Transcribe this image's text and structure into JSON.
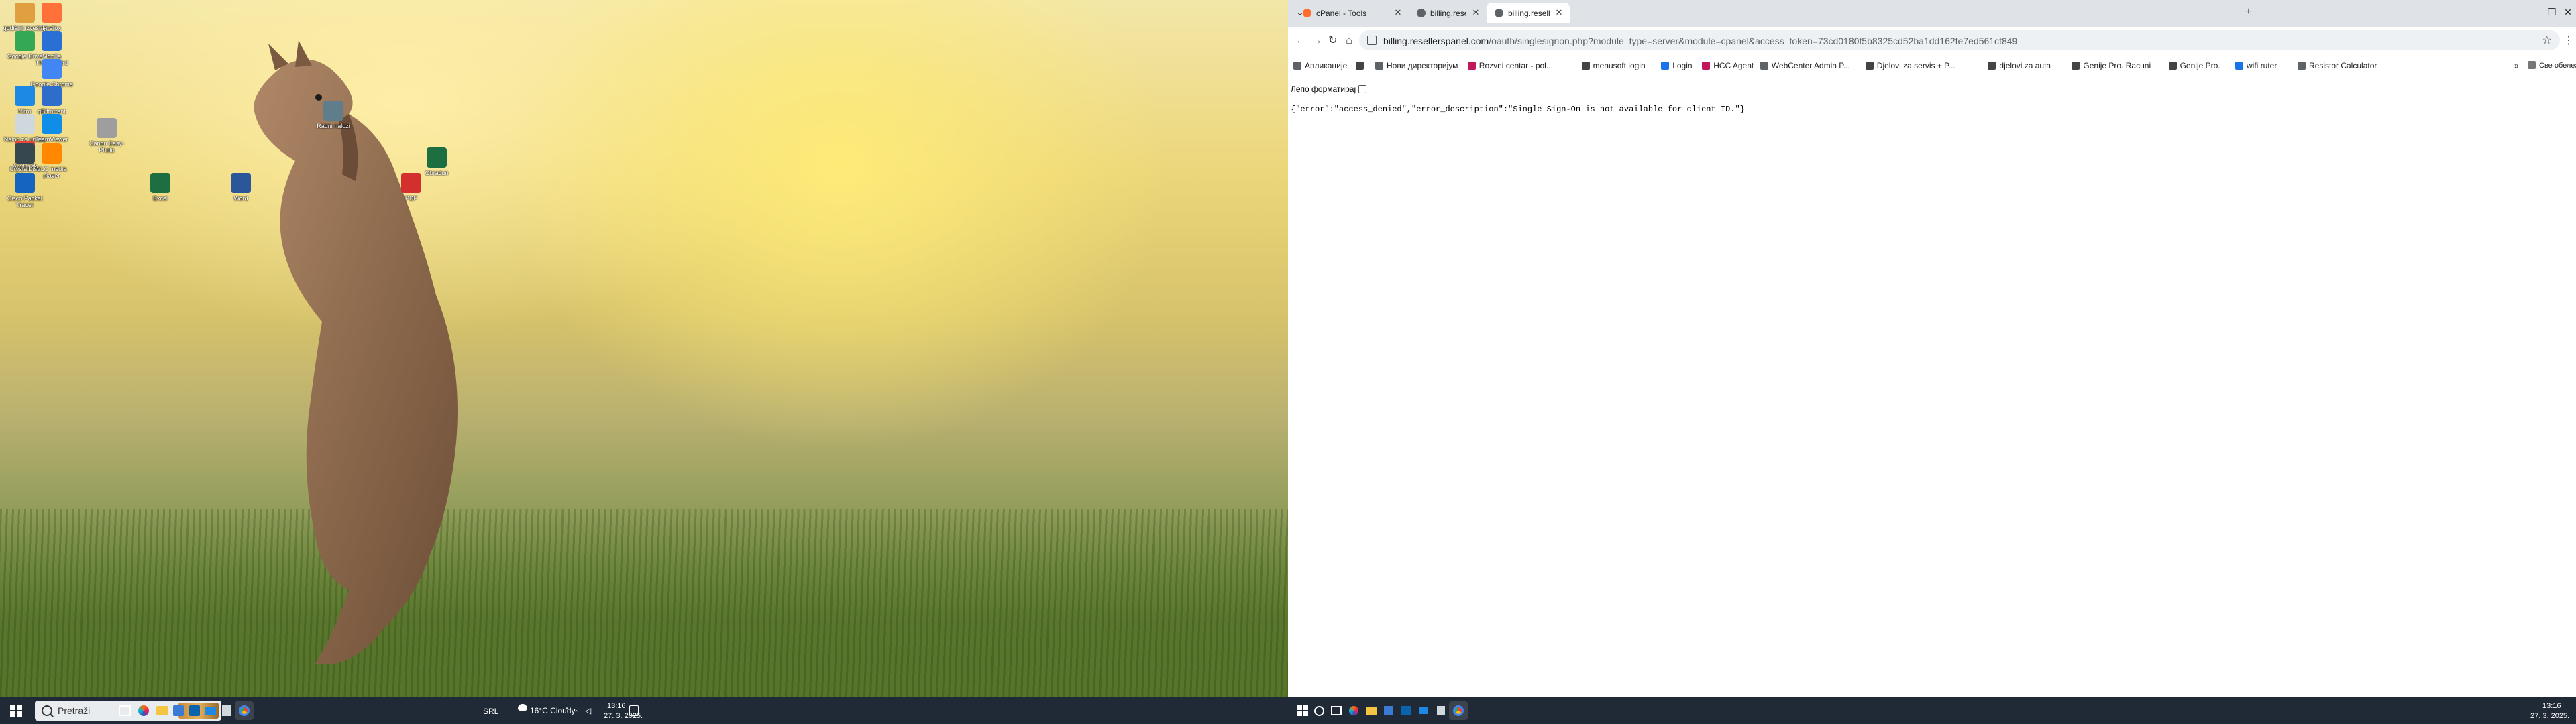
{
  "desktop": {
    "icons": [
      {
        "label": "godišnji izveštaji",
        "color": "#e0a040"
      },
      {
        "label": "Firefox",
        "color": "#ff7139"
      },
      {
        "label": "Google Drive",
        "color": "#34a853"
      },
      {
        "label": "Mozilla Thunderbird",
        "color": "#2a6fd4"
      },
      {
        "label": "Google Chrome",
        "color": "#4285f4"
      },
      {
        "label": "Nitro",
        "color": "#1e88e5"
      },
      {
        "label": "qBittorrent",
        "color": "#2e6dc9"
      },
      {
        "label": "Nalog za uplatu",
        "color": "#cfd8dc"
      },
      {
        "label": "AnyDesk",
        "color": "#ef443b"
      },
      {
        "label": "TeamViewer",
        "color": "#0e8ee9"
      },
      {
        "label": "Canon Easy-Photo",
        "color": "#9e9e9e"
      },
      {
        "label": "CrystalDisk Mark",
        "color": "#37474f"
      },
      {
        "label": "VLC media player",
        "color": "#ff8800"
      },
      {
        "label": "Cisco Packet Tracer",
        "color": "#1565c0"
      },
      {
        "label": "Excel",
        "color": "#1d6f42"
      },
      {
        "label": "Word",
        "color": "#2b579a"
      },
      {
        "label": "PDF",
        "color": "#d32f2f"
      },
      {
        "label": "Obračun",
        "color": "#1d6f42"
      },
      {
        "label": "Radni nalozi",
        "color": "#607d8b"
      }
    ]
  },
  "taskbar_left": {
    "search_placeholder": "Pretraži",
    "weather": "16°C  Cloudy",
    "lang": "SRL",
    "time": "13:16",
    "date": "27. 3. 2025."
  },
  "browser": {
    "tabs": [
      {
        "label": "cPanel - Tools",
        "active": false,
        "favicon_color": "#ff6c2c"
      },
      {
        "label": "billing.resellerspanel.com/oauth",
        "active": false,
        "favicon_color": "#5f6368"
      },
      {
        "label": "billing.resellerspanel.com/oauth",
        "active": true,
        "favicon_color": "#5f6368"
      }
    ],
    "new_tab_label": "+",
    "url_host": "billing.resellerspanel.com",
    "url_path": "/oauth/singlesignon.php?module_type=server&module=cpanel&access_token=73cd0180f5b8325cd52ba1dd162fe7ed561cf849",
    "bookmarks": [
      {
        "label": "Апликације",
        "color": "#5f6368"
      },
      {
        "label": "",
        "color": "#444"
      },
      {
        "label": "Нови директоријум",
        "color": "#5f6368"
      },
      {
        "label": "Rozvni centar - pol...",
        "color": "#c2185b"
      },
      {
        "label": "menusoft login",
        "color": "#444"
      },
      {
        "label": "Login",
        "color": "#1a73e8"
      },
      {
        "label": "HCC Agent",
        "color": "#c2185b"
      },
      {
        "label": "WebCenter Admin P...",
        "color": "#5f6368"
      },
      {
        "label": "Djelovi za servis + P...",
        "color": "#444"
      },
      {
        "label": "djelovi za auta",
        "color": "#444"
      },
      {
        "label": "Genije Pro. Racuni",
        "color": "#444"
      },
      {
        "label": "Genije Pro.",
        "color": "#444"
      },
      {
        "label": "wifi ruter",
        "color": "#1a73e8"
      },
      {
        "label": "Resistor Calculator",
        "color": "#5f6368"
      }
    ],
    "all_bookmarks_label": "Све обележиваче",
    "pretty_print_label": "Лепо форматирај",
    "json_body": "{\"error\":\"access_denied\",\"error_description\":\"Single Sign-On is not available for client ID.\"}"
  },
  "taskbar_right": {
    "time": "13:16",
    "date": "27. 3. 2025."
  }
}
